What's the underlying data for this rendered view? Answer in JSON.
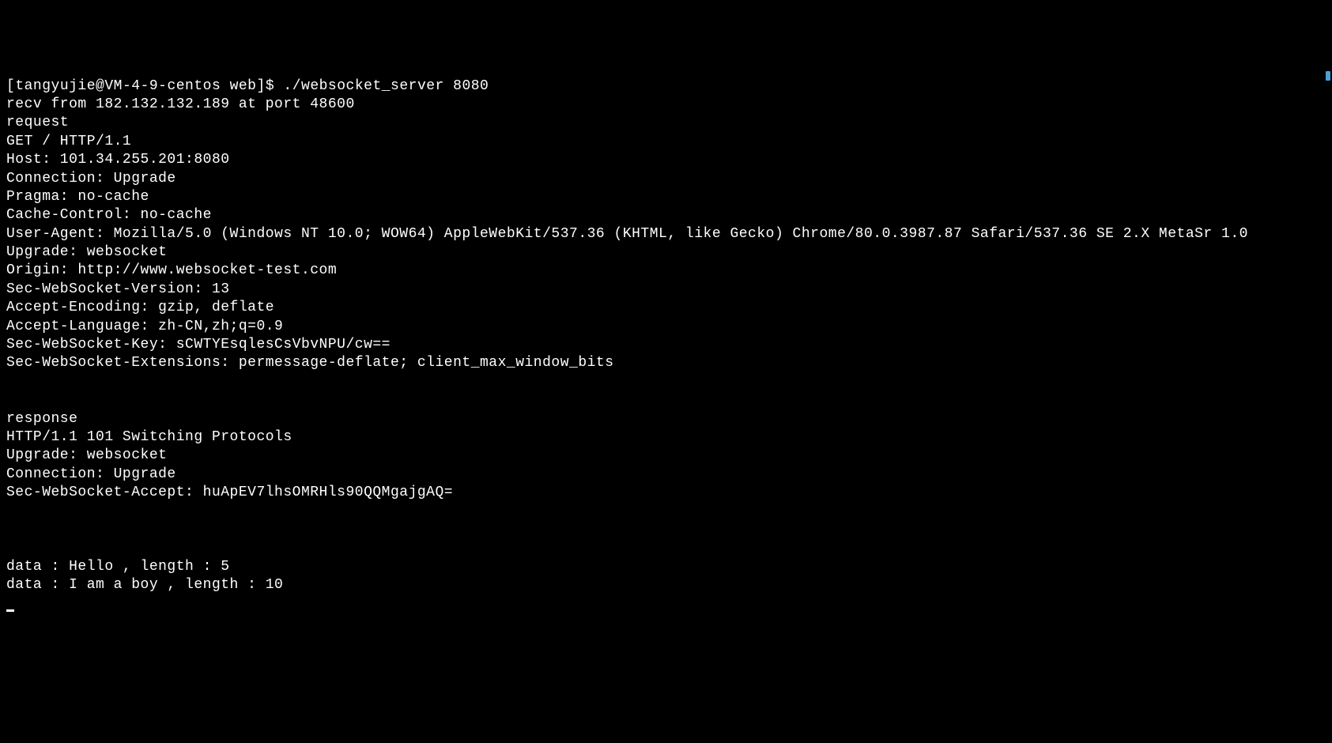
{
  "prompt": {
    "open_bracket": "[",
    "user": "tangyujie",
    "at": "@",
    "host": "VM-4-9-centos",
    "dir": " web",
    "close_bracket": "]",
    "symbol": "$ "
  },
  "command": "./websocket_server 8080",
  "output": {
    "lines": [
      "recv from 182.132.132.189 at port 48600",
      "request",
      "GET / HTTP/1.1",
      "Host: 101.34.255.201:8080",
      "Connection: Upgrade",
      "Pragma: no-cache",
      "Cache-Control: no-cache",
      "User-Agent: Mozilla/5.0 (Windows NT 10.0; WOW64) AppleWebKit/537.36 (KHTML, like Gecko) Chrome/80.0.3987.87 Safari/537.36 SE 2.X MetaSr 1.0",
      "Upgrade: websocket",
      "Origin: http://www.websocket-test.com",
      "Sec-WebSocket-Version: 13",
      "Accept-Encoding: gzip, deflate",
      "Accept-Language: zh-CN,zh;q=0.9",
      "Sec-WebSocket-Key: sCWTYEsqlesCsVbvNPU/cw==",
      "Sec-WebSocket-Extensions: permessage-deflate; client_max_window_bits",
      "",
      "",
      "response",
      "HTTP/1.1 101 Switching Protocols",
      "Upgrade: websocket",
      "Connection: Upgrade",
      "Sec-WebSocket-Accept: huApEV7lhsOMRHls90QQMgajgAQ=",
      "",
      "",
      "",
      "data : Hello , length : 5",
      "data : I am a boy , length : 10"
    ]
  }
}
